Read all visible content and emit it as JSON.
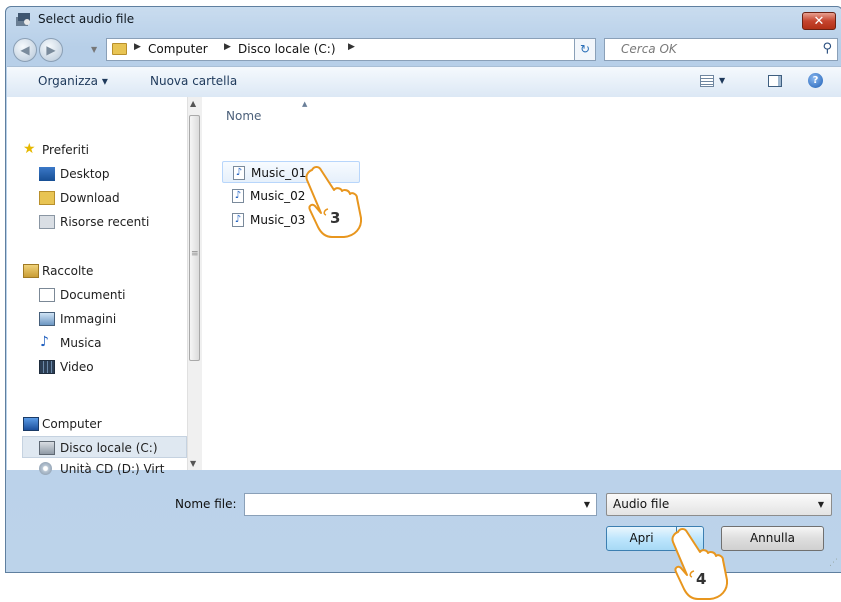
{
  "window": {
    "title": "Select audio file",
    "close_label": "✕"
  },
  "address": {
    "back_glyph": "◀",
    "forward_glyph": "▶",
    "crumbs": [
      "Computer",
      "Disco locale (C:)"
    ],
    "separator_glyph": "▶",
    "refresh_glyph": "↻",
    "search_placeholder": "Cerca OK"
  },
  "toolbar": {
    "organize_label": "Organizza ▾",
    "new_folder_label": "Nuova cartella"
  },
  "nav": {
    "favorites": {
      "title": "Preferiti",
      "items": [
        "Desktop",
        "Download",
        "Risorse recenti"
      ]
    },
    "libraries": {
      "title": "Raccolte",
      "items": [
        "Documenti",
        "Immagini",
        "Musica",
        "Video"
      ]
    },
    "computer": {
      "title": "Computer",
      "items": [
        "Disco locale (C:)",
        "Unità CD (D:) Virt"
      ],
      "selected": "Disco locale (C:)"
    }
  },
  "files": {
    "column_header": "Nome",
    "items": [
      "Music_01",
      "Music_02",
      "Music_03"
    ],
    "hovered": "Music_01"
  },
  "bottom": {
    "filename_label": "Nome file:",
    "filename_value": "",
    "filetype_value": "Audio file",
    "open_label": "Apri",
    "cancel_label": "Annulla"
  },
  "annotations": {
    "step_a": "3",
    "step_b": "4"
  },
  "icons": {
    "title": "app-icon",
    "folder": "folder-icon",
    "search": "search-icon",
    "favorites": "star-icon",
    "audio": "audio-file-icon",
    "help": "help-icon"
  },
  "colors": {
    "window_frame": "#bcd3ea",
    "toolbar": "#dce8f5",
    "close_button": "#c5442e",
    "default_button": "#bee6fd"
  }
}
